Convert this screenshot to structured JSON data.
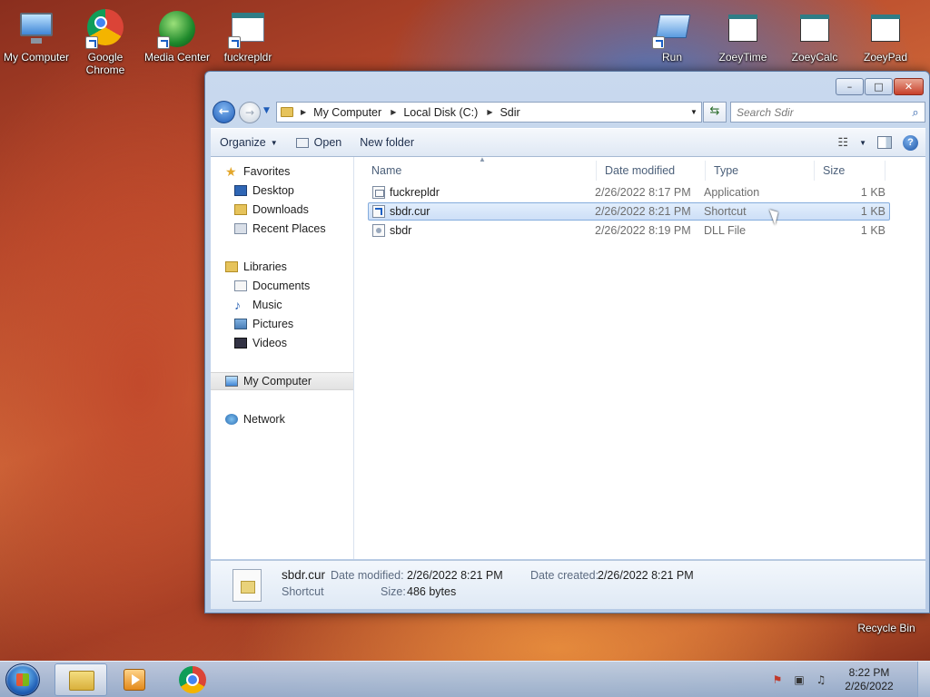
{
  "desktop": {
    "icons": [
      {
        "label": "My Computer",
        "icon": "computer-icon"
      },
      {
        "label": "Google Chrome",
        "icon": "chrome-icon"
      },
      {
        "label": "Media Center",
        "icon": "media-center-icon"
      },
      {
        "label": "fuckrepldr",
        "icon": "app-icon"
      },
      {
        "label": "Run",
        "icon": "run-icon"
      },
      {
        "label": "ZoeyTime",
        "icon": "app-icon"
      },
      {
        "label": "ZoeyCalc",
        "icon": "app-icon"
      },
      {
        "label": "ZoeyPad",
        "icon": "app-icon"
      },
      {
        "label": "Recycle Bin",
        "icon": "recycle-bin-icon"
      }
    ]
  },
  "explorer": {
    "title_buttons": {
      "minimize": "–",
      "maximize": "□",
      "close": "✕"
    },
    "address": {
      "crumbs": [
        "My Computer",
        "Local Disk (C:)",
        "Sdir"
      ]
    },
    "search": {
      "placeholder": "Search Sdir"
    },
    "toolbar": {
      "organize": "Organize",
      "open": "Open",
      "new_folder": "New folder"
    },
    "nav": {
      "favorites": "Favorites",
      "desktop": "Desktop",
      "downloads": "Downloads",
      "recent_places": "Recent Places",
      "libraries": "Libraries",
      "documents": "Documents",
      "music": "Music",
      "pictures": "Pictures",
      "videos": "Videos",
      "my_computer": "My Computer",
      "network": "Network"
    },
    "columns": {
      "name": "Name",
      "date": "Date modified",
      "type": "Type",
      "size": "Size"
    },
    "files": [
      {
        "name": "fuckrepldr",
        "date": "2/26/2022 8:17 PM",
        "type": "Application",
        "size": "1 KB"
      },
      {
        "name": "sbdr.cur",
        "date": "2/26/2022 8:21 PM",
        "type": "Shortcut",
        "size": "1 KB"
      },
      {
        "name": "sbdr",
        "date": "2/26/2022 8:19 PM",
        "type": "DLL File",
        "size": "1 KB"
      }
    ],
    "details": {
      "name": "sbdr.cur",
      "type": "Shortcut",
      "modified_label": "Date modified:",
      "modified_value": "2/26/2022 8:21 PM",
      "created_label": "Date created:",
      "created_value": "2/26/2022 8:21 PM",
      "size_label": "Size:",
      "size_value": "486 bytes"
    }
  },
  "taskbar": {
    "time": "8:22 PM",
    "date": "2/26/2022"
  }
}
